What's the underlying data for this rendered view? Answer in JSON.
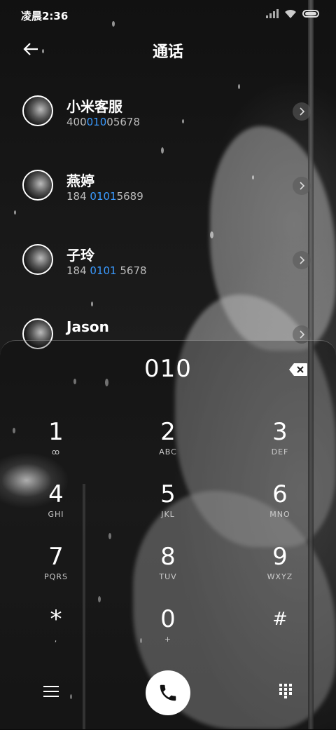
{
  "status_bar": {
    "time": "凌晨2:36"
  },
  "header": {
    "title": "通话"
  },
  "contacts": [
    {
      "name": "小米客服",
      "number_parts": [
        "400",
        "010",
        "05678"
      ]
    },
    {
      "name": "燕婷",
      "number_parts": [
        "184 ",
        "0101",
        "5689"
      ]
    },
    {
      "name": "子玲",
      "number_parts": [
        "184 ",
        "0101",
        " 5678"
      ]
    },
    {
      "name": "Jason",
      "number_parts": [
        "",
        "",
        ""
      ]
    }
  ],
  "dialpad": {
    "input": "010",
    "keys": [
      {
        "digit": "1",
        "letters": "ꝏ"
      },
      {
        "digit": "2",
        "letters": "ABC"
      },
      {
        "digit": "3",
        "letters": "DEF"
      },
      {
        "digit": "4",
        "letters": "GHI"
      },
      {
        "digit": "5",
        "letters": "JKL"
      },
      {
        "digit": "6",
        "letters": "MNO"
      },
      {
        "digit": "7",
        "letters": "PQRS"
      },
      {
        "digit": "8",
        "letters": "TUV"
      },
      {
        "digit": "9",
        "letters": "WXYZ"
      },
      {
        "digit": "*",
        "letters": ","
      },
      {
        "digit": "0",
        "letters": "+"
      },
      {
        "digit": "#",
        "letters": ""
      }
    ]
  },
  "colors": {
    "highlight": "#3a9aff"
  },
  "icons": [
    "back-arrow-icon",
    "signal-icon",
    "wifi-icon",
    "battery-icon",
    "chevron-right-icon",
    "backspace-icon",
    "menu-icon",
    "phone-icon",
    "keypad-grid-icon"
  ]
}
